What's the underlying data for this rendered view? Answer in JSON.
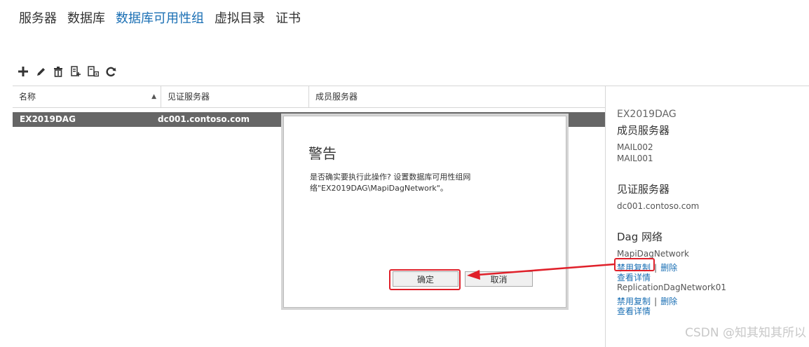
{
  "nav": {
    "items": [
      "服务器",
      "数据库",
      "数据库可用性组",
      "虚拟目录",
      "证书"
    ],
    "active_index": 2
  },
  "toolbar": {
    "icons": [
      "add-icon",
      "edit-icon",
      "delete-icon",
      "witness-icon",
      "members-icon",
      "refresh-icon"
    ]
  },
  "table": {
    "columns": [
      "名称",
      "见证服务器",
      "成员服务器"
    ],
    "sort_indicator": "▲",
    "rows": [
      {
        "name": "EX2019DAG",
        "witness": "dc001.contoso.com",
        "members": ""
      }
    ]
  },
  "details": {
    "dag_name": "EX2019DAG",
    "members_heading": "成员服务器",
    "members": [
      "MAIL002",
      "MAIL001"
    ],
    "witness_heading": "见证服务器",
    "witness_value": "dc001.contoso.com",
    "networks_heading": "Dag 网络",
    "networks": [
      {
        "name": "MapiDagNetwork",
        "disable_label": "禁用复制",
        "separator": "|",
        "delete_label": "删除",
        "details_label": "查看详情"
      },
      {
        "name": "ReplicationDagNetwork01",
        "disable_label": "禁用复制",
        "separator": "|",
        "delete_label": "删除",
        "details_label": "查看详情"
      }
    ]
  },
  "dialog": {
    "title": "警告",
    "message": "是否确实要执行此操作? 设置数据库可用性组网络\"EX2019DAG\\MapiDagNetwork\"。",
    "ok_label": "确定",
    "cancel_label": "取消"
  },
  "colors": {
    "accent": "#1a6fb4",
    "selected_row": "#666666",
    "annotation": "#e0202a"
  },
  "watermark": "CSDN @知其知其所以"
}
